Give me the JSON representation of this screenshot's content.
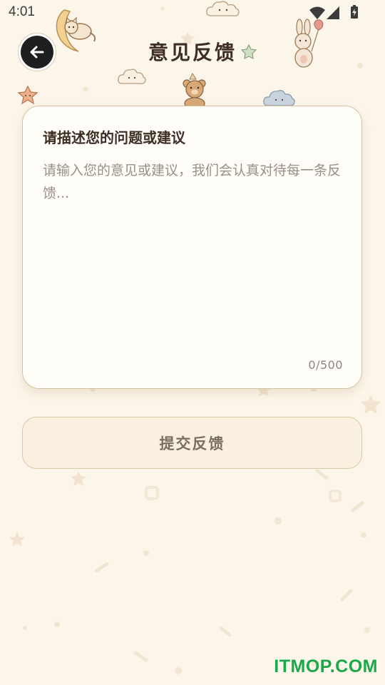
{
  "status_bar": {
    "time": "4:01",
    "icons": [
      "wifi-icon",
      "signal-icon",
      "battery-icon"
    ]
  },
  "header": {
    "title": "意见反馈",
    "back_icon": "arrow-left-icon"
  },
  "feedback_form": {
    "heading": "请描述您的问题或建议",
    "placeholder": "请输入您的意见或建议，我们会认真对待每一条反馈...",
    "value": "",
    "counter": "0/500"
  },
  "submit_button": {
    "label": "提交反馈"
  },
  "watermark": "ITMOP.COM",
  "colors": {
    "background": "#fcf6ea",
    "card": "#fffdf8",
    "card_border": "#d6c3a6",
    "button_bg": "#faf0df",
    "title_text": "#3e2e24",
    "placeholder_text": "#9a8f86",
    "watermark": "#1aa84a"
  }
}
